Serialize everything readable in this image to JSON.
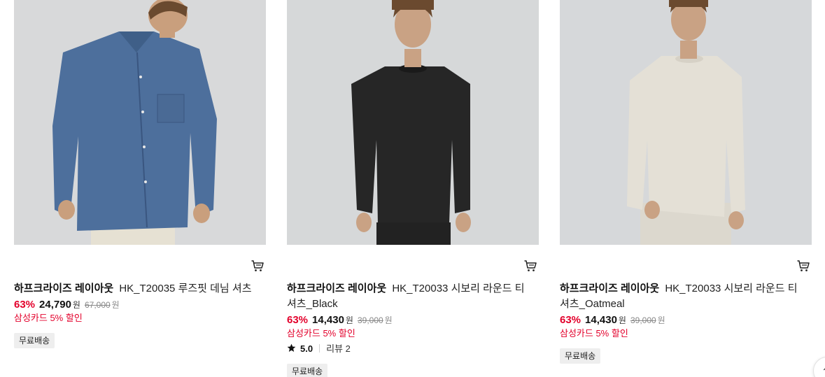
{
  "products": [
    {
      "brand": "하프크라이즈 레이아웃",
      "name": "HK_T20035 루즈핏 데님 셔츠",
      "discount_rate": "63%",
      "price": "24,790",
      "price_unit": "원",
      "original_price": "67,000",
      "original_unit": "원",
      "card_benefit": "삼성카드 5% 할인",
      "badge": "무료배송",
      "image_icon": "denim-shirt-photo",
      "garment_color": "#4d6f9c"
    },
    {
      "brand": "하프크라이즈 레이아웃",
      "name": "HK_T20033 시보리 라운드 티셔츠_Black",
      "discount_rate": "63%",
      "price": "14,430",
      "price_unit": "원",
      "original_price": "39,000",
      "original_unit": "원",
      "card_benefit": "삼성카드 5% 할인",
      "rating": "5.0",
      "review": "리뷰 2",
      "badge": "무료배송",
      "image_icon": "black-sweatshirt-photo",
      "garment_color": "#262626"
    },
    {
      "brand": "하프크라이즈 레이아웃",
      "name": "HK_T20033 시보리 라운드 티셔츠_Oatmeal",
      "discount_rate": "63%",
      "price": "14,430",
      "price_unit": "원",
      "original_price": "39,000",
      "original_unit": "원",
      "card_benefit": "삼성카드 5% 할인",
      "badge": "무료배송",
      "image_icon": "oatmeal-sweatshirt-photo",
      "garment_color": "#e4e0d6"
    }
  ],
  "colors": {
    "discount": "#e3002b",
    "badge_bg": "#eeeeee",
    "photo_bg": "#d9d9d7"
  },
  "icons": {
    "cart": "cart-icon",
    "star": "star-icon",
    "scroll_top": "chevron-up-icon"
  }
}
